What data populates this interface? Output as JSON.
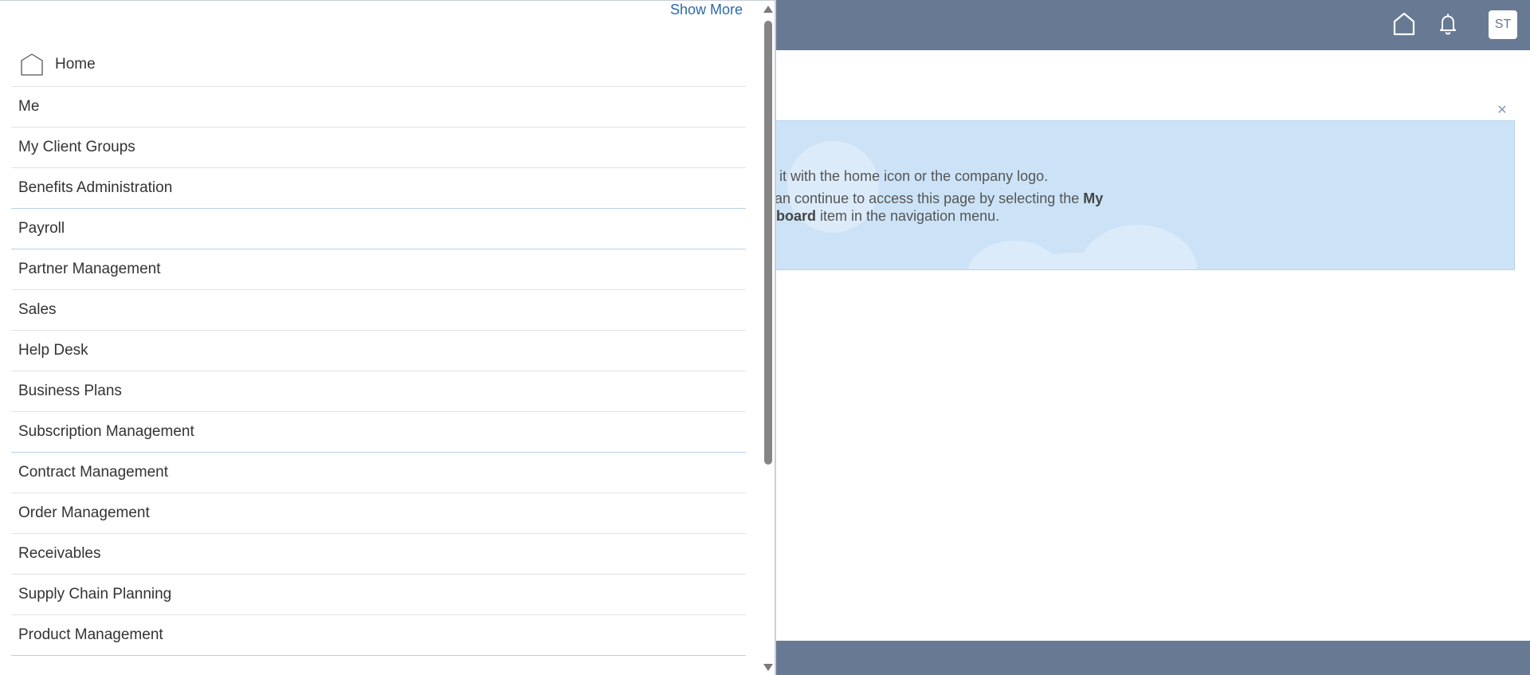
{
  "header": {
    "home_icon": "home-outline-icon",
    "bell_icon": "bell-icon",
    "avatar_initials": "ST",
    "bar_color": "#687a93"
  },
  "banner": {
    "line1": "n it with the home icon or the company logo.",
    "line2_pre": "can continue to access this page by selecting the ",
    "line2_bold": "My",
    "line3_bold": "hboard",
    "line3_post": " item in the navigation menu.",
    "close_icon": "close-icon",
    "background": "#cce3f7"
  },
  "nav": {
    "show_more": "Show More",
    "home_label": "Home",
    "items": [
      "Me",
      "My Client Groups",
      "Benefits Administration",
      "Payroll",
      "Partner Management",
      "Sales",
      "Help Desk",
      "Business Plans",
      "Subscription Management",
      "Contract Management",
      "Order Management",
      "Receivables",
      "Supply Chain Planning",
      "Product Management"
    ]
  }
}
